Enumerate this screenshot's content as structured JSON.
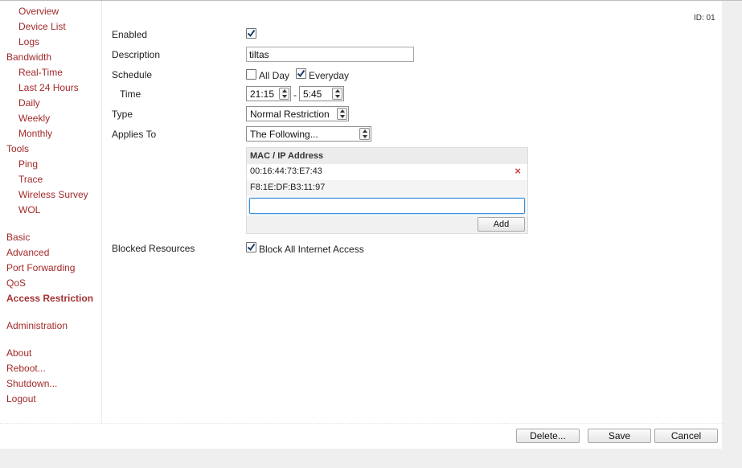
{
  "sidebar": {
    "items": [
      {
        "label": "Overview",
        "sub": true
      },
      {
        "label": "Device List",
        "sub": true
      },
      {
        "label": "Logs",
        "sub": true
      },
      {
        "label": "Bandwidth",
        "sub": false
      },
      {
        "label": "Real-Time",
        "sub": true
      },
      {
        "label": "Last 24 Hours",
        "sub": true
      },
      {
        "label": "Daily",
        "sub": true
      },
      {
        "label": "Weekly",
        "sub": true
      },
      {
        "label": "Monthly",
        "sub": true
      },
      {
        "label": "Tools",
        "sub": false
      },
      {
        "label": "Ping",
        "sub": true
      },
      {
        "label": "Trace",
        "sub": true
      },
      {
        "label": "Wireless Survey",
        "sub": true
      },
      {
        "label": "WOL",
        "sub": true
      },
      {
        "label": "Basic",
        "sub": false
      },
      {
        "label": "Advanced",
        "sub": false
      },
      {
        "label": "Port Forwarding",
        "sub": false
      },
      {
        "label": "QoS",
        "sub": false
      },
      {
        "label": "Access Restriction",
        "sub": false,
        "active": true
      },
      {
        "label": "Administration",
        "sub": false
      },
      {
        "label": "About",
        "sub": false
      },
      {
        "label": "Reboot...",
        "sub": false
      },
      {
        "label": "Shutdown...",
        "sub": false
      },
      {
        "label": "Logout",
        "sub": false
      }
    ]
  },
  "rule": {
    "id_label": "ID: 01",
    "enabled_label": "Enabled",
    "enabled_checked": true,
    "description_label": "Description",
    "description_value": "tiltas",
    "schedule_label": "Schedule",
    "all_day_label": "All Day",
    "all_day_checked": false,
    "everyday_label": "Everyday",
    "everyday_checked": true,
    "time_label": "Time",
    "time_start": "21:15",
    "time_separator": "-",
    "time_end": "5:45",
    "type_label": "Type",
    "type_value": "Normal Restriction",
    "applies_to_label": "Applies To",
    "applies_to_value": "The Following...",
    "mac_table": {
      "header": "MAC / IP Address",
      "rows": [
        "00:16:44:73:E7:43",
        "F8:1E:DF:B3:11:97"
      ],
      "delete_glyph": "×",
      "input_value": "",
      "add_label": "Add"
    },
    "blocked_label": "Blocked Resources",
    "block_all_label": "Block All Internet Access",
    "block_all_checked": true
  },
  "footer": {
    "delete_label": "Delete...",
    "save_label": "Save",
    "cancel_label": "Cancel"
  },
  "colors": {
    "nav_link": "#a22a2a",
    "input_focus": "#3d8fd6",
    "delete_x": "#d04040"
  }
}
